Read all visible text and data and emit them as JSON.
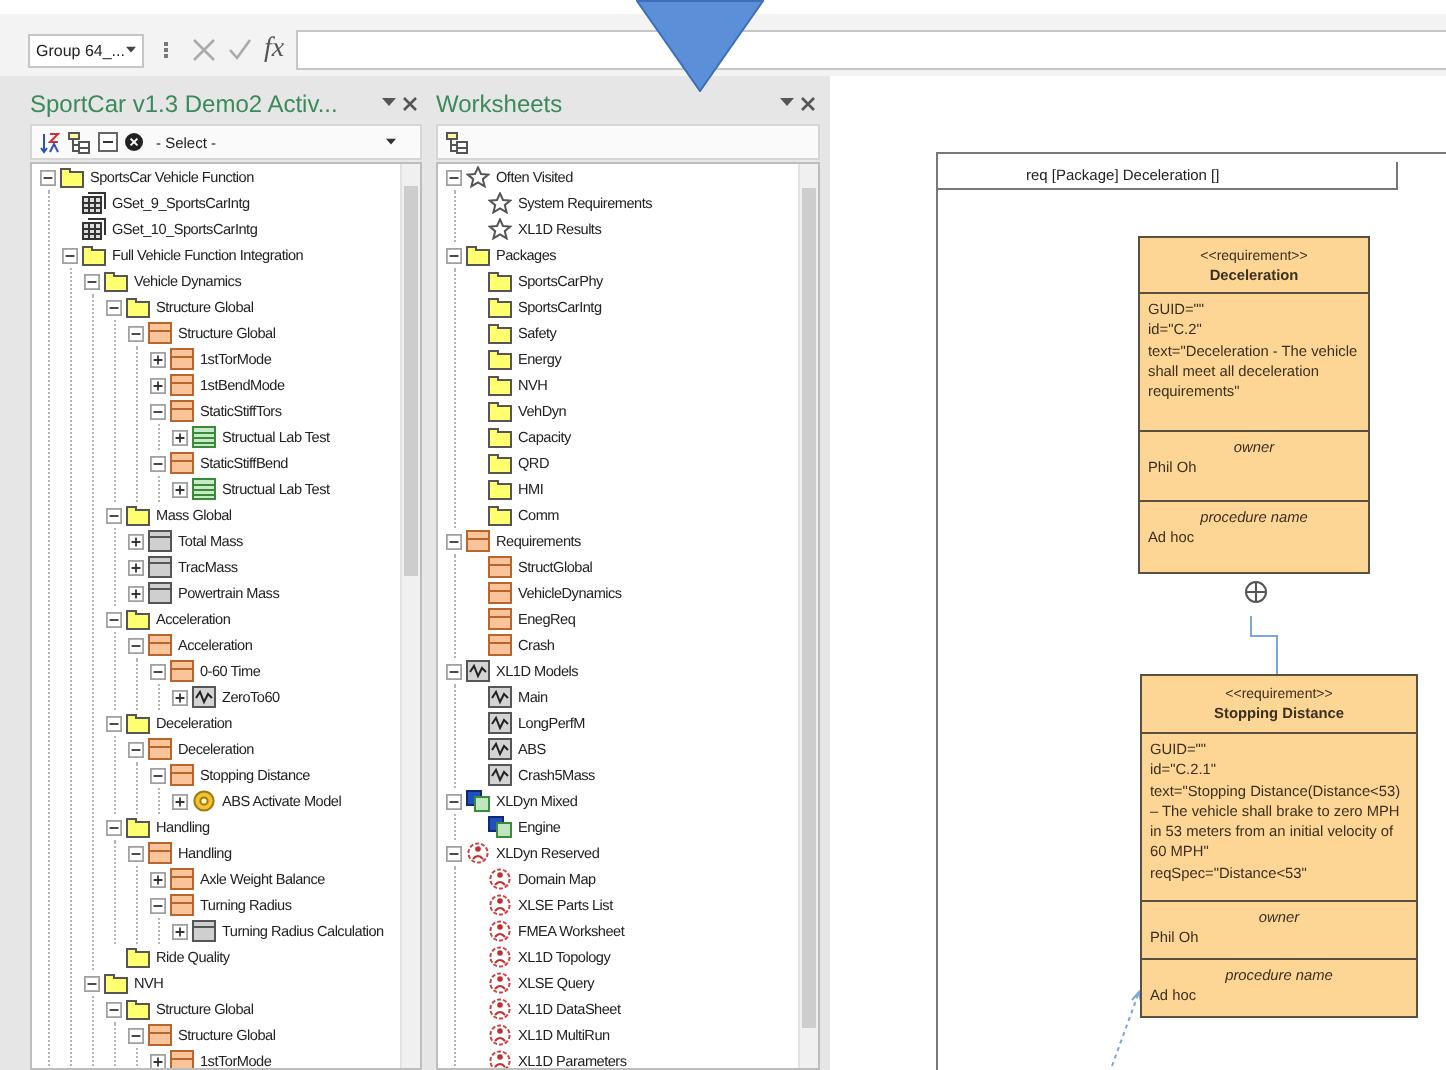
{
  "formula_bar": {
    "name_box": "Group 64_...",
    "function_label": "fx"
  },
  "left_panel": {
    "title": "SportCar v1.3 Demo2 Activ...",
    "select": {
      "value": "- Select -"
    },
    "tree": [
      {
        "label": "SportsCar Vehicle Function",
        "kind": "folder",
        "expanded": true,
        "children": [
          {
            "label": "GSet_9_SportsCarIntg",
            "kind": "grid"
          },
          {
            "label": "GSet_10_SportsCarIntg",
            "kind": "grid"
          },
          {
            "label": "Full Vehicle Function Integration",
            "kind": "folder",
            "expanded": true,
            "children": [
              {
                "label": "Vehicle Dynamics",
                "kind": "folder",
                "expanded": true,
                "children": [
                  {
                    "label": "Structure Global",
                    "kind": "folder",
                    "expanded": true,
                    "children": [
                      {
                        "label": "Structure Global",
                        "kind": "requirement",
                        "expanded": true,
                        "children": [
                          {
                            "label": "1stTorMode",
                            "kind": "requirement",
                            "expanded": false
                          },
                          {
                            "label": "1stBendMode",
                            "kind": "requirement",
                            "expanded": false
                          },
                          {
                            "label": "StaticStiffTors",
                            "kind": "requirement",
                            "expanded": true,
                            "children": [
                              {
                                "label": "Structual Lab Test",
                                "kind": "test",
                                "expanded": false
                              }
                            ]
                          },
                          {
                            "label": "StaticStiffBend",
                            "kind": "requirement",
                            "expanded": true,
                            "children": [
                              {
                                "label": "Structual Lab Test",
                                "kind": "test",
                                "expanded": false
                              }
                            ]
                          }
                        ]
                      }
                    ]
                  },
                  {
                    "label": "Mass Global",
                    "kind": "folder",
                    "expanded": true,
                    "children": [
                      {
                        "label": "Total Mass",
                        "kind": "block",
                        "expanded": false
                      },
                      {
                        "label": "TracMass",
                        "kind": "block",
                        "expanded": false
                      },
                      {
                        "label": "Powertrain Mass",
                        "kind": "block",
                        "expanded": false
                      }
                    ]
                  },
                  {
                    "label": "Acceleration",
                    "kind": "folder",
                    "expanded": true,
                    "children": [
                      {
                        "label": "Acceleration",
                        "kind": "requirement",
                        "expanded": true,
                        "children": [
                          {
                            "label": "0-60 Time",
                            "kind": "requirement",
                            "expanded": true,
                            "children": [
                              {
                                "label": "ZeroTo60",
                                "kind": "model",
                                "expanded": false
                              }
                            ]
                          }
                        ]
                      }
                    ]
                  },
                  {
                    "label": "Deceleration",
                    "kind": "folder",
                    "expanded": true,
                    "children": [
                      {
                        "label": "Deceleration",
                        "kind": "requirement",
                        "expanded": true,
                        "children": [
                          {
                            "label": "Stopping Distance",
                            "kind": "requirement",
                            "expanded": true,
                            "children": [
                              {
                                "label": "ABS Activate Model",
                                "kind": "gear",
                                "expanded": false
                              }
                            ]
                          }
                        ]
                      }
                    ]
                  },
                  {
                    "label": "Handling",
                    "kind": "folder",
                    "expanded": true,
                    "children": [
                      {
                        "label": "Handling",
                        "kind": "requirement",
                        "expanded": true,
                        "children": [
                          {
                            "label": "Axle Weight Balance",
                            "kind": "requirement",
                            "expanded": false
                          },
                          {
                            "label": "Turning Radius",
                            "kind": "requirement",
                            "expanded": true,
                            "children": [
                              {
                                "label": "Turning Radius Calculation",
                                "kind": "block",
                                "expanded": false
                              }
                            ]
                          }
                        ]
                      }
                    ]
                  },
                  {
                    "label": "Ride Quality",
                    "kind": "folder"
                  }
                ]
              },
              {
                "label": "NVH",
                "kind": "folder",
                "expanded": true,
                "children": [
                  {
                    "label": "Structure Global",
                    "kind": "folder",
                    "expanded": true,
                    "children": [
                      {
                        "label": "Structure Global",
                        "kind": "requirement",
                        "expanded": true,
                        "children": [
                          {
                            "label": "1stTorMode",
                            "kind": "requirement",
                            "expanded": false
                          }
                        ]
                      }
                    ]
                  }
                ]
              }
            ]
          }
        ]
      }
    ]
  },
  "middle_panel": {
    "title": "Worksheets",
    "tree": [
      {
        "label": "Often Visited",
        "kind": "star",
        "expanded": true,
        "children": [
          {
            "label": "System Requirements",
            "kind": "star"
          },
          {
            "label": "XL1D Results",
            "kind": "star"
          }
        ]
      },
      {
        "label": "Packages",
        "kind": "folder",
        "expanded": true,
        "children": [
          {
            "label": "SportsCarPhy",
            "kind": "folder"
          },
          {
            "label": "SportsCarIntg",
            "kind": "folder"
          },
          {
            "label": "Safety",
            "kind": "folder"
          },
          {
            "label": "Energy",
            "kind": "folder"
          },
          {
            "label": "NVH",
            "kind": "folder"
          },
          {
            "label": "VehDyn",
            "kind": "folder"
          },
          {
            "label": "Capacity",
            "kind": "folder"
          },
          {
            "label": "QRD",
            "kind": "folder"
          },
          {
            "label": "HMI",
            "kind": "folder"
          },
          {
            "label": "Comm",
            "kind": "folder"
          }
        ]
      },
      {
        "label": "Requirements",
        "kind": "requirement",
        "expanded": true,
        "children": [
          {
            "label": "StructGlobal",
            "kind": "requirement"
          },
          {
            "label": "VehicleDynamics",
            "kind": "requirement"
          },
          {
            "label": "EnegReq",
            "kind": "requirement"
          },
          {
            "label": "Crash",
            "kind": "requirement"
          }
        ]
      },
      {
        "label": "XL1D Models",
        "kind": "model",
        "expanded": true,
        "children": [
          {
            "label": "Main",
            "kind": "model"
          },
          {
            "label": "LongPerfM",
            "kind": "model"
          },
          {
            "label": "ABS",
            "kind": "model"
          },
          {
            "label": "Crash5Mass",
            "kind": "model"
          }
        ]
      },
      {
        "label": "XLDyn Mixed",
        "kind": "mixed",
        "expanded": true,
        "children": [
          {
            "label": "Engine",
            "kind": "mixed"
          }
        ]
      },
      {
        "label": "XLDyn Reserved",
        "kind": "reserved",
        "expanded": true,
        "children": [
          {
            "label": "Domain Map",
            "kind": "reserved"
          },
          {
            "label": "XLSE Parts List",
            "kind": "reserved"
          },
          {
            "label": "FMEA Worksheet",
            "kind": "reserved"
          },
          {
            "label": "XL1D Topology",
            "kind": "reserved"
          },
          {
            "label": "XLSE Query",
            "kind": "reserved"
          },
          {
            "label": "XL1D DataSheet",
            "kind": "reserved"
          },
          {
            "label": "XL1D MultiRun",
            "kind": "reserved"
          },
          {
            "label": "XL1D Parameters",
            "kind": "reserved"
          }
        ]
      }
    ]
  },
  "diagram": {
    "frame_title": "req [Package] Deceleration []",
    "requirements": [
      {
        "stereotype": "<<requirement>>",
        "name": "Deceleration",
        "properties": [
          "GUID=\"\"",
          "id=\"C.2\"",
          "text=\"Deceleration - The vehicle shall meet all deceleration requirements\""
        ],
        "owner_label": "owner",
        "owner": "Phil Oh",
        "procedure_label": "procedure name",
        "procedure": "Ad hoc"
      },
      {
        "stereotype": "<<requirement>>",
        "name": "Stopping Distance",
        "properties": [
          "GUID=\"\"",
          "id=\"C.2.1\"",
          "text=\"Stopping Distance(Distance<53) – The vehicle shall brake to zero MPH in 53 meters from an initial velocity of 60 MPH\"",
          "reqSpec=\"Distance<53\""
        ],
        "owner_label": "owner",
        "owner": "Phil Oh",
        "procedure_label": "procedure name",
        "procedure": "Ad hoc"
      }
    ]
  }
}
